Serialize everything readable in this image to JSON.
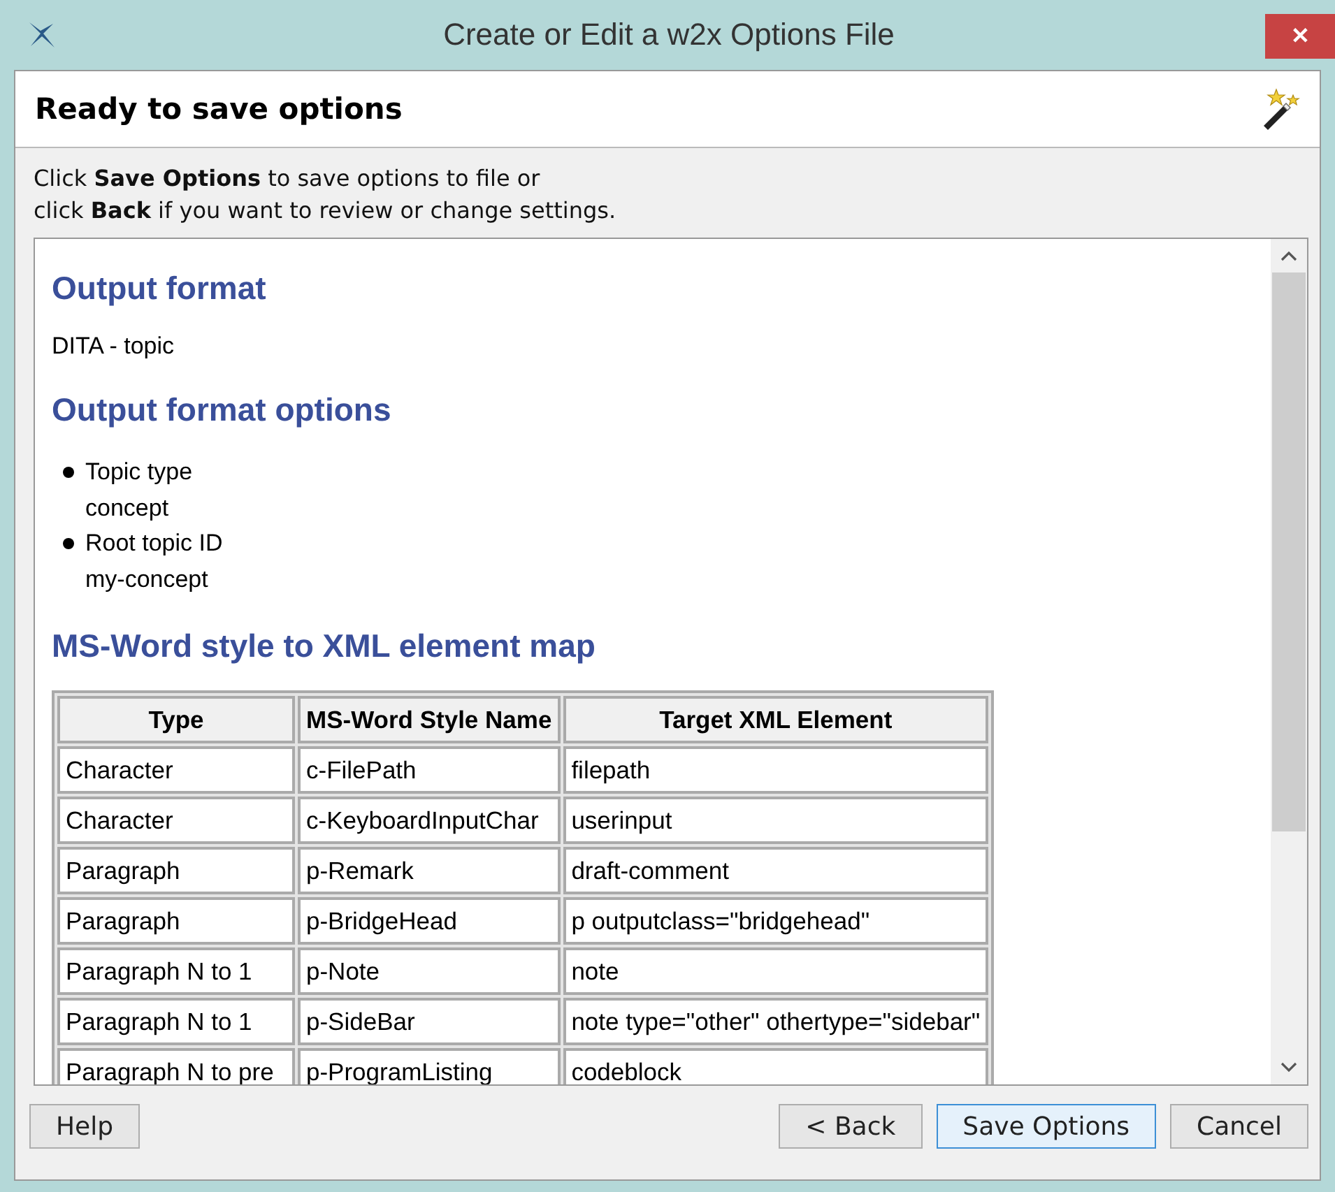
{
  "window": {
    "title": "Create or Edit a w2x Options File",
    "close": "✕"
  },
  "header": {
    "title": "Ready to save options"
  },
  "instructions": [
    "Click **Save Options** to save options to file or",
    "click **Back** if you want to review or change settings."
  ],
  "sections": [
    {
      "kind": "text",
      "heading": "Output format",
      "text": "DITA - topic"
    },
    {
      "kind": "list",
      "heading": "Output format options",
      "items": [
        {
          "label": "Topic type",
          "value": "concept"
        },
        {
          "label": "Root topic ID",
          "value": "my-concept"
        }
      ]
    },
    {
      "kind": "table",
      "heading": "MS-Word style to XML element map",
      "columns": [
        "Type",
        "MS-Word Style Name",
        "Target XML Element"
      ],
      "rows": [
        [
          "Character",
          "c-FilePath",
          "filepath"
        ],
        [
          "Character",
          "c-KeyboardInputChar",
          "userinput"
        ],
        [
          "Paragraph",
          "p-Remark",
          "draft-comment"
        ],
        [
          "Paragraph",
          "p-BridgeHead",
          "p outputclass=\"bridgehead\""
        ],
        [
          "Paragraph N to 1",
          "p-Note",
          "note"
        ],
        [
          "Paragraph N to 1",
          "p-SideBar",
          "note type=\"other\" othertype=\"sidebar\""
        ],
        [
          "Paragraph N to pre",
          "p-ProgramListing",
          "codeblock"
        ]
      ]
    }
  ],
  "buttons": [
    {
      "label": "Help",
      "selected": false
    },
    {
      "label": "< Back",
      "selected": false
    },
    {
      "label": "Save Options",
      "selected": true
    },
    {
      "label": "Cancel",
      "selected": false
    }
  ]
}
